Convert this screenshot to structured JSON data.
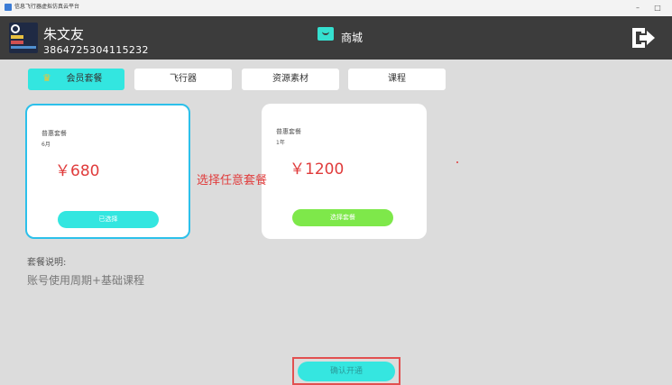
{
  "window": {
    "title": "信息飞行器虚拟仿真云平台",
    "minimize_glyph": "–",
    "maximize_glyph": "□"
  },
  "header": {
    "user_name": "朱文友",
    "user_id": "3864725304115232",
    "section_label": "商城",
    "shop_icon": "shopping-bag-icon",
    "exit_icon": "logout-icon"
  },
  "tabs": [
    {
      "label": "会员套餐",
      "active": true,
      "icon": "crown-icon"
    },
    {
      "label": "飞行器",
      "active": false
    },
    {
      "label": "资源素材",
      "active": false
    },
    {
      "label": "课程",
      "active": false
    }
  ],
  "packages": [
    {
      "name": "普惠套餐",
      "duration": "6月",
      "price": "￥680",
      "button_label": "已选择",
      "selected": true
    },
    {
      "name": "普惠套餐",
      "duration": "1年",
      "price": "￥1200",
      "button_label": "选择套餐",
      "selected": false
    }
  ],
  "hint": "选择任意套餐",
  "description": {
    "title": "套餐说明:",
    "text": "账号使用周期+基础课程"
  },
  "confirm_label": "确认开通",
  "colors": {
    "accent_cyan": "#33e6e0",
    "selected_blue": "#2cc0ea",
    "select_green": "#7ee84a",
    "price_red": "#e03c3c",
    "header_bg": "#3c3c3c"
  }
}
